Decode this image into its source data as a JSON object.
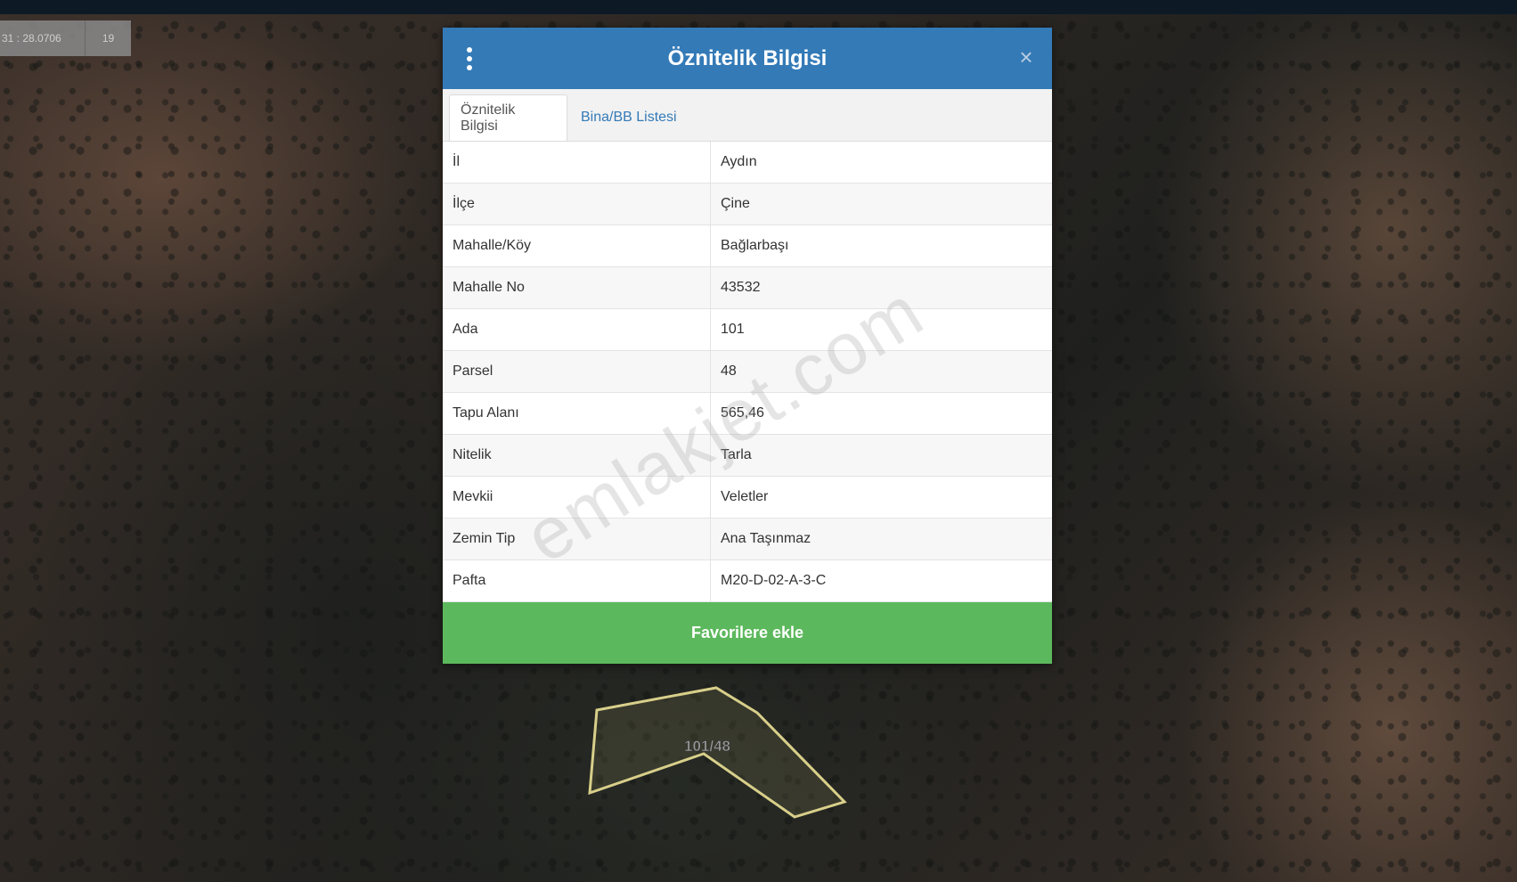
{
  "map": {
    "scale_text": "31 : 28.0706",
    "zoom_level": "19",
    "parcel_label": "101/48"
  },
  "dialog": {
    "title": "Öznitelik Bilgisi",
    "close_symbol": "×",
    "menu_icon": "vertical-dots-icon",
    "tabs": [
      {
        "label": "Öznitelik Bilgisi",
        "active": true
      },
      {
        "label": "Bina/BB Listesi",
        "active": false
      }
    ],
    "rows": [
      {
        "key": "İl",
        "value": "Aydın"
      },
      {
        "key": "İlçe",
        "value": "Çine"
      },
      {
        "key": "Mahalle/Köy",
        "value": "Bağlarbaşı"
      },
      {
        "key": "Mahalle No",
        "value": "43532"
      },
      {
        "key": "Ada",
        "value": "101"
      },
      {
        "key": "Parsel",
        "value": "48"
      },
      {
        "key": "Tapu Alanı",
        "value": "565,46"
      },
      {
        "key": "Nitelik",
        "value": "Tarla"
      },
      {
        "key": "Mevkii",
        "value": "Veletler"
      },
      {
        "key": "Zemin Tip",
        "value": "Ana Taşınmaz"
      },
      {
        "key": "Pafta",
        "value": "M20-D-02-A-3-C"
      }
    ],
    "favorite_button": "Favorilere ekle"
  },
  "watermark": "emlakjet.com",
  "colors": {
    "header_blue": "#337ab7",
    "button_green": "#5cb85c",
    "parcel_outline": "#d8cf8a"
  }
}
